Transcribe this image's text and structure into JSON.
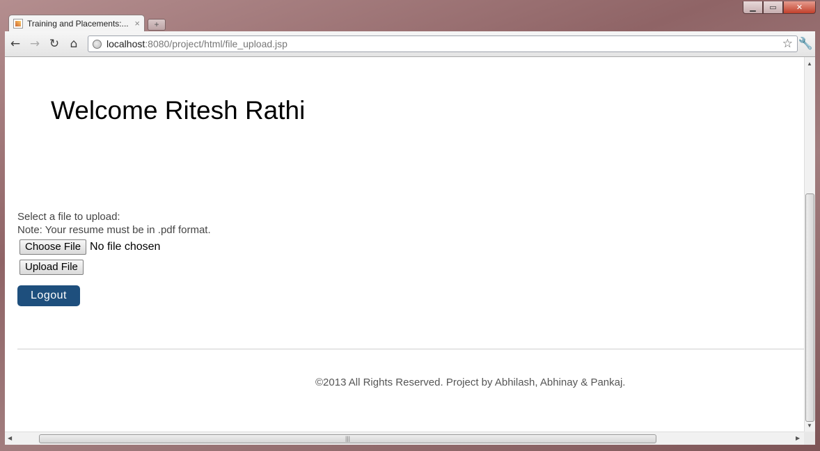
{
  "browser": {
    "tab_title": "Training and Placements:...",
    "tab_close": "×",
    "new_tab": "+",
    "url_host": "localhost",
    "url_path": ":8080/project/html/file_upload.jsp",
    "icons": {
      "back": "back-arrow-icon",
      "forward": "forward-arrow-icon",
      "reload": "reload-icon",
      "home": "home-icon",
      "page": "globe-icon",
      "bookmark": "star-icon",
      "settings": "wrench-icon"
    }
  },
  "page": {
    "welcome": "Welcome Ritesh Rathi",
    "select_label": "Select a file to upload:",
    "note": "Note: Your resume must be in .pdf format.",
    "choose_file": "Choose File",
    "file_status": "No file chosen",
    "upload_button": "Upload File",
    "logout": "Logout",
    "footer": "©2013 All Rights Reserved. Project by Abhilash, Abhinay & Pankaj."
  },
  "colors": {
    "logout_bg": "#1e4f7d",
    "frame": "#8f6466"
  }
}
